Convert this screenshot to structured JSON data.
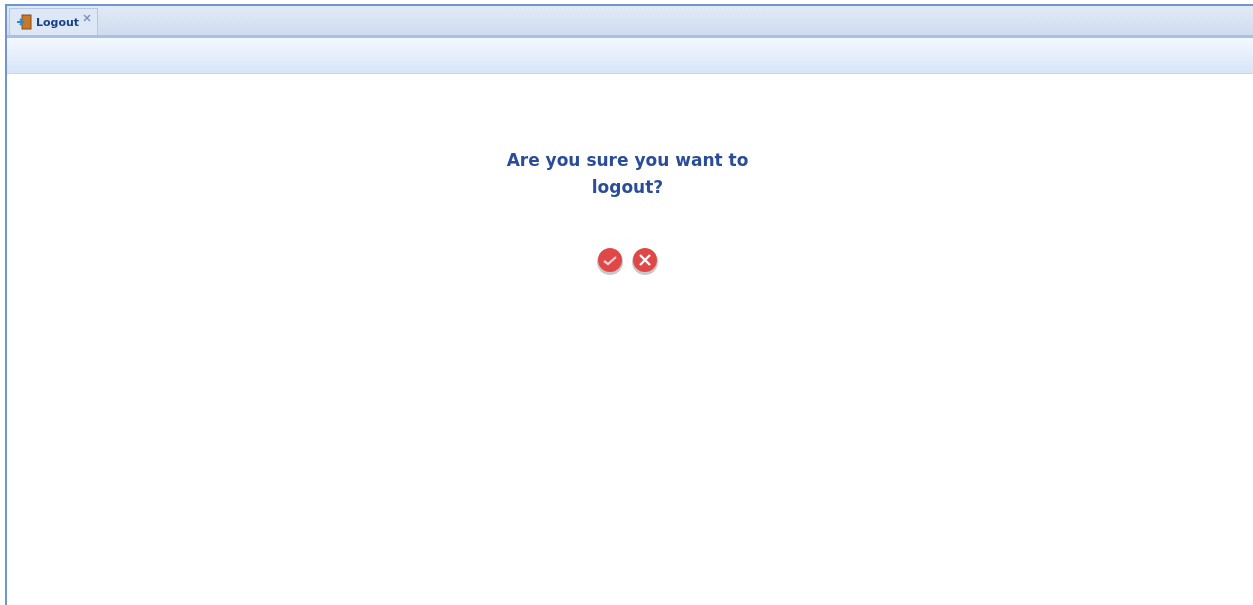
{
  "tabs": [
    {
      "label": "Logout",
      "selected": true
    }
  ],
  "dialog": {
    "message": "Are you sure you want to logout?"
  }
}
